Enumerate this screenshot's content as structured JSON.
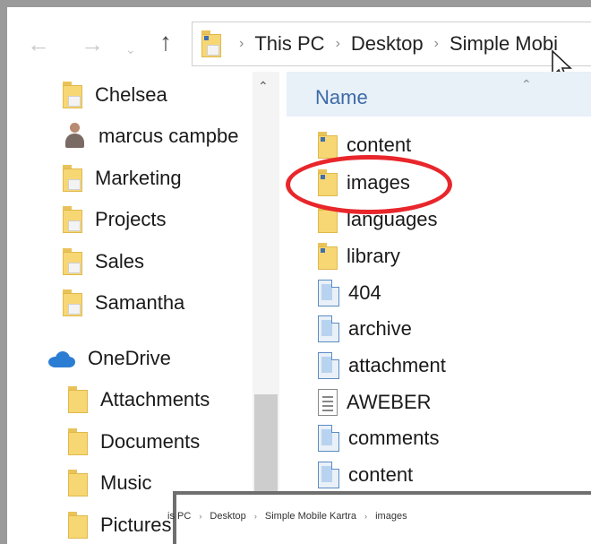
{
  "toolbar": {
    "back_icon": "←",
    "forward_icon": "→",
    "recent_icon": "⌄",
    "up_icon": "↑"
  },
  "address_bar": {
    "crumbs": [
      "This PC",
      "Desktop",
      "Simple Mobi"
    ]
  },
  "sidebar": {
    "items": [
      {
        "label": "Chelsea",
        "icon": "folder-icon"
      },
      {
        "label": "marcus campbe",
        "icon": "user-icon"
      },
      {
        "label": "Marketing",
        "icon": "folder-icon"
      },
      {
        "label": "Projects",
        "icon": "folder-icon"
      },
      {
        "label": "Sales",
        "icon": "folder-icon"
      },
      {
        "label": "Samantha",
        "icon": "folder-icon"
      },
      {
        "label": "OneDrive",
        "icon": "onedrive-icon"
      },
      {
        "label": "Attachments",
        "icon": "folder-icon"
      },
      {
        "label": "Documents",
        "icon": "folder-icon"
      },
      {
        "label": "Music",
        "icon": "folder-icon"
      },
      {
        "label": "Pictures",
        "icon": "folder-icon"
      }
    ]
  },
  "file_list": {
    "column_header": "Name",
    "items": [
      {
        "name": "content",
        "type": "folder"
      },
      {
        "name": "images",
        "type": "folder",
        "highlighted": true
      },
      {
        "name": "languages",
        "type": "folder"
      },
      {
        "name": "library",
        "type": "folder"
      },
      {
        "name": "404",
        "type": "php-file"
      },
      {
        "name": "archive",
        "type": "php-file"
      },
      {
        "name": "attachment",
        "type": "php-file"
      },
      {
        "name": "AWEBER",
        "type": "text-file"
      },
      {
        "name": "comments",
        "type": "php-file"
      },
      {
        "name": "content",
        "type": "php-file"
      }
    ]
  },
  "highlight_color": "#e8262b",
  "overlay_address": {
    "crumbs": [
      "is PC",
      "Desktop",
      "Simple Mobile Kartra",
      "images"
    ]
  }
}
